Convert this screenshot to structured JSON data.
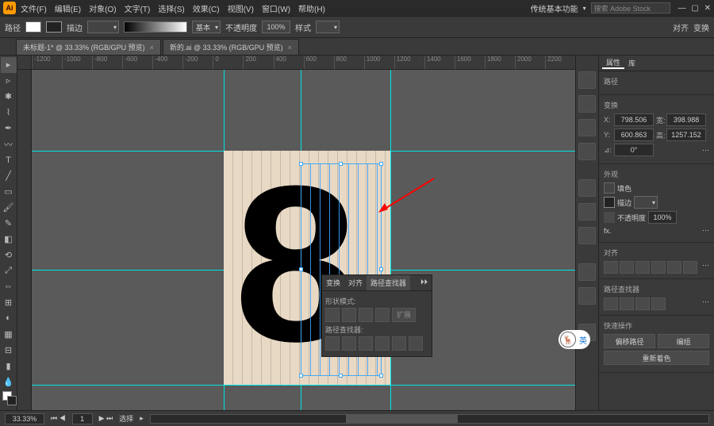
{
  "app": {
    "logo": "Ai"
  },
  "menu": {
    "items": [
      "文件(F)",
      "编辑(E)",
      "对象(O)",
      "文字(T)",
      "选择(S)",
      "效果(C)",
      "视图(V)",
      "窗口(W)",
      "帮助(H)"
    ],
    "workspace_label": "传统基本功能",
    "search_placeholder": "搜索 Adobe Stock"
  },
  "control": {
    "label_path": "路径",
    "label_stroke": "描边",
    "stroke_weight": "",
    "style_label": "基本",
    "opacity_label": "不透明度",
    "opacity_value": "100%",
    "fx_label": "样式",
    "align_label": "对齐",
    "transform_label": "变换"
  },
  "tabs": [
    {
      "label": "未标题-1* @ 33.33% (RGB/GPU 预览)",
      "active": true
    },
    {
      "label": "新的.ai @ 33.33% (RGB/GPU 预览)",
      "active": false
    }
  ],
  "ruler_marks": [
    "-1200",
    "-1000",
    "-800",
    "-600",
    "-400",
    "-200",
    "0",
    "200",
    "400",
    "600",
    "800",
    "1000",
    "1200",
    "1400",
    "1600",
    "1800",
    "2000",
    "2200"
  ],
  "glyph": "8",
  "pathfinder": {
    "tabs": [
      "变换",
      "对齐",
      "路径查找器"
    ],
    "shape_label": "形状模式:",
    "expand_label": "扩展",
    "pf_label": "路径查找器:"
  },
  "props": {
    "tabs": [
      "属性",
      "库"
    ],
    "type_label": "路径",
    "transform_label": "变换",
    "x_label": "X:",
    "x": "798.506",
    "w_label": "宽:",
    "w": "398.988",
    "y_label": "Y:",
    "y": "600.863",
    "h_label": "高:",
    "h": "1257.152",
    "angle_label": "⊿:",
    "angle": "0°",
    "appearance_label": "外观",
    "fill_label": "填色",
    "stroke_label": "描边",
    "opacity_label": "不透明度",
    "opacity_value": "100%",
    "fx_label": "fx.",
    "align_label": "对齐",
    "pathfinder_label": "路径查找器",
    "quick_label": "快速操作",
    "btn_offset": "偏移路径",
    "btn_arrange": "编组",
    "btn_recolor": "重新着色"
  },
  "status": {
    "zoom": "33.33%",
    "nav": "1",
    "tool": "选择"
  },
  "badge_text": "英"
}
